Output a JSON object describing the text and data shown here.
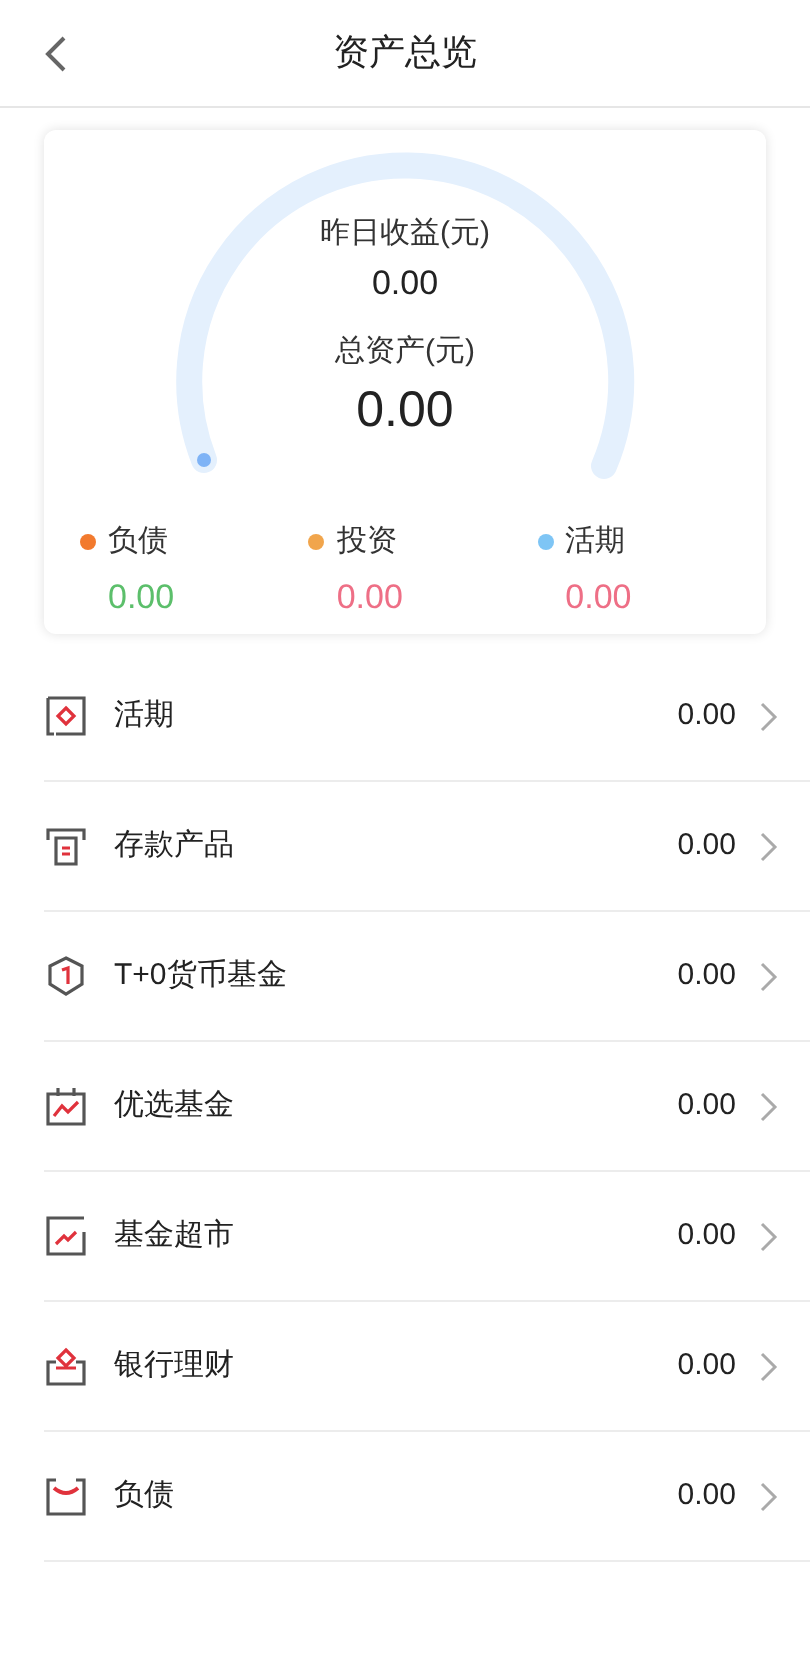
{
  "header": {
    "title": "资产总览"
  },
  "summary": {
    "yesterday_label": "昨日收益(元)",
    "yesterday_value": "0.00",
    "total_label": "总资产(元)",
    "total_value": "0.00",
    "legend": [
      {
        "label": "负债",
        "value": "0.00",
        "color": "#f27a2e",
        "kind": "liability"
      },
      {
        "label": "投资",
        "value": "0.00",
        "color": "#f1a54c",
        "kind": "asset"
      },
      {
        "label": "活期",
        "value": "0.00",
        "color": "#7ec5f5",
        "kind": "asset"
      }
    ]
  },
  "items": [
    {
      "kind": "current",
      "label": "活期",
      "value": "0.00"
    },
    {
      "kind": "deposit",
      "label": "存款产品",
      "value": "0.00"
    },
    {
      "kind": "shield",
      "label": "T+0货币基金",
      "value": "0.00"
    },
    {
      "kind": "calendar",
      "label": "优选基金",
      "value": "0.00"
    },
    {
      "kind": "chart",
      "label": "基金超市",
      "value": "0.00"
    },
    {
      "kind": "tray",
      "label": "银行理财",
      "value": "0.00"
    },
    {
      "kind": "envelope",
      "label": "负债",
      "value": "0.00"
    }
  ]
}
